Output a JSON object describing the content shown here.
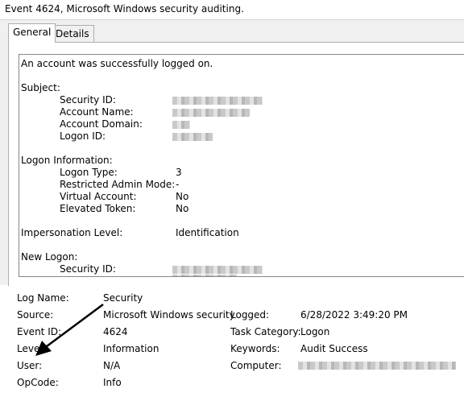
{
  "window": {
    "title": "Event 4624, Microsoft Windows security auditing."
  },
  "tabs": [
    {
      "label": "General",
      "active": true
    },
    {
      "label": "Details",
      "active": false
    }
  ],
  "description": {
    "headline": "An account was successfully logged on.",
    "subject": {
      "heading": "Subject:",
      "security_id_label": "Security ID:",
      "account_name_label": "Account Name:",
      "account_domain_label": "Account Domain:",
      "logon_id_label": "Logon ID:"
    },
    "logon_information": {
      "heading": "Logon Information:",
      "logon_type_label": "Logon Type:",
      "logon_type_value": "3",
      "restricted_admin_mode_label": "Restricted Admin Mode:",
      "restricted_admin_mode_value": "-",
      "virtual_account_label": "Virtual Account:",
      "virtual_account_value": "No",
      "elevated_token_label": "Elevated Token:",
      "elevated_token_value": "No"
    },
    "impersonation": {
      "label": "Impersonation Level:",
      "value": "Identification"
    },
    "new_logon": {
      "heading": "New Logon:",
      "security_id_label": "Security ID:"
    }
  },
  "details": {
    "log_name_label": "Log Name:",
    "log_name_value": "Security",
    "source_label": "Source:",
    "source_value": "Microsoft Windows security",
    "logged_label": "Logged:",
    "logged_value": "6/28/2022 3:49:20 PM",
    "event_id_label": "Event ID:",
    "event_id_value": "4624",
    "task_category_label": "Task Category:",
    "task_category_value": "Logon",
    "level_label": "Level:",
    "level_value": "Information",
    "keywords_label": "Keywords:",
    "keywords_value": "Audit Success",
    "user_label": "User:",
    "user_value": "N/A",
    "computer_label": "Computer:",
    "opcode_label": "OpCode:",
    "opcode_value": "Info"
  },
  "colors": {
    "highlight": "#f6f05a",
    "arrow": "#000000",
    "panel_background": "#f0f0f0"
  }
}
